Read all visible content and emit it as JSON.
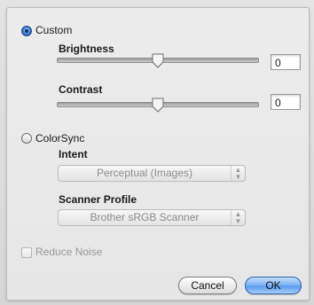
{
  "custom": {
    "label": "Custom",
    "selected": true
  },
  "brightness": {
    "label": "Brightness",
    "value": "0",
    "slider_fraction": 0.5
  },
  "contrast": {
    "label": "Contrast",
    "value": "0",
    "slider_fraction": 0.5
  },
  "colorsync": {
    "label": "ColorSync",
    "selected": false
  },
  "intent": {
    "label": "Intent",
    "selected_option": "Perceptual (Images)"
  },
  "scanner_profile": {
    "label": "Scanner Profile",
    "selected_option": "Brother sRGB Scanner"
  },
  "reduce_noise": {
    "label": "Reduce Noise",
    "checked": false
  },
  "buttons": {
    "cancel": "Cancel",
    "ok": "OK"
  },
  "colors": {
    "default_button": "#5b9bed",
    "radio_selected": "#2f6fcf"
  }
}
